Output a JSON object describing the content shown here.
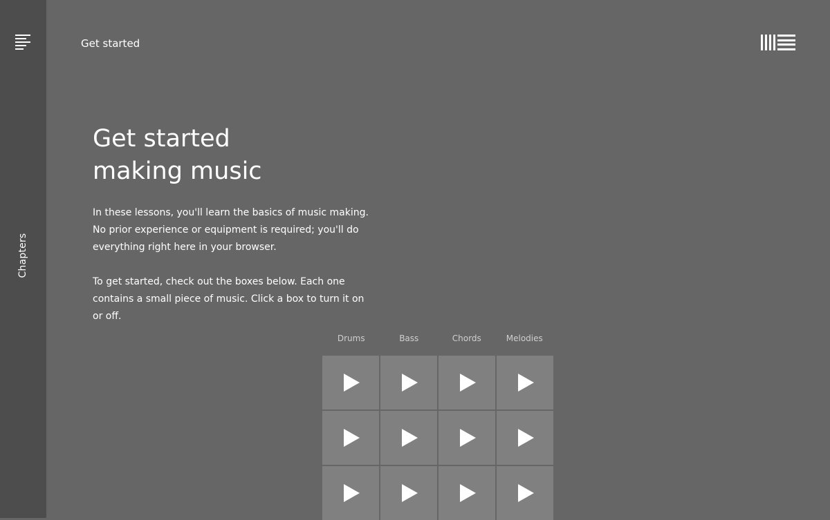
{
  "sidebar": {
    "menu_icon": "menu-lines-icon",
    "chapters_label": "Chapters"
  },
  "header": {
    "title": "Get started",
    "logo_icon": "ableton-logo-icon"
  },
  "hero": {
    "title_line1": "Get started",
    "title_line2": "making music"
  },
  "intro": {
    "paragraph1": "In these lessons, you'll learn the basics of music making. No prior experience or equipment is required; you'll do everything right here in your browser.",
    "paragraph2": "To get started, check out the boxes below. Each one contains a small piece of music. Click a box to turn it on or off."
  },
  "grid": {
    "columns": [
      "Drums",
      "Bass",
      "Chords",
      "Melodies"
    ],
    "play_icon": "play-icon",
    "colors": {
      "background": "#666666",
      "sidebar": "#4d4d4d",
      "cell": "#808080",
      "header_text": "#cfcfcf"
    }
  }
}
